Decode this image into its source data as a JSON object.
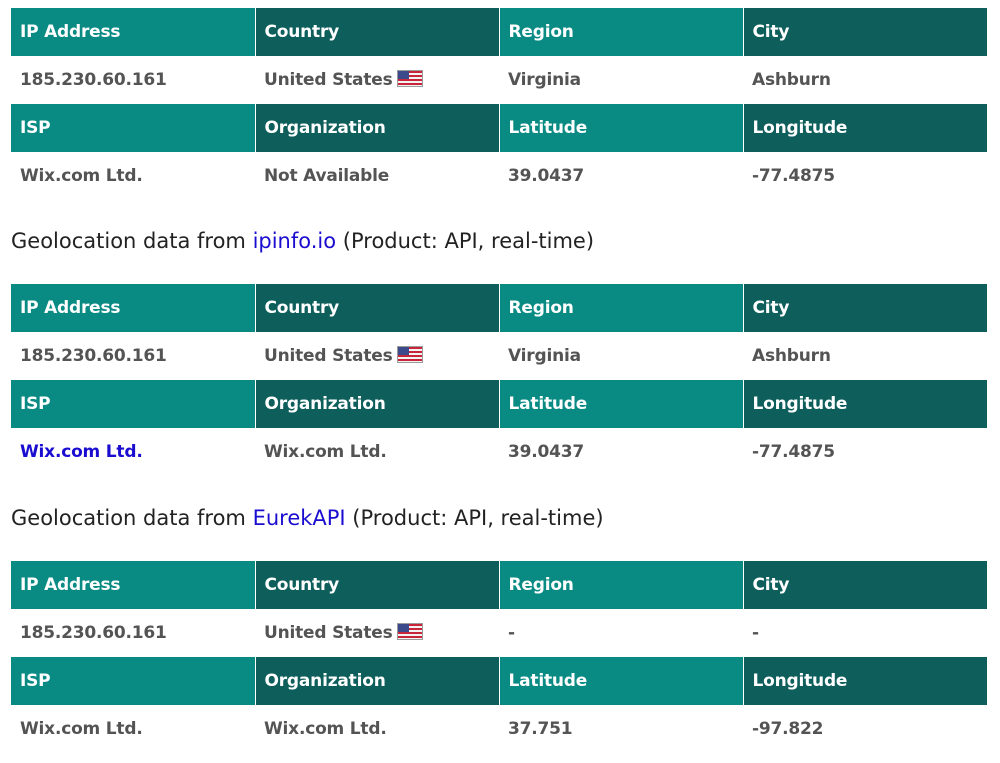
{
  "headers_top": [
    "IP Address",
    "Country",
    "Region",
    "City"
  ],
  "headers_bottom": [
    "ISP",
    "Organization",
    "Latitude",
    "Longitude"
  ],
  "flag_icon": "us-flag-icon",
  "colors": {
    "header_light": "#098b84",
    "header_dark": "#0e5f5c",
    "link": "#1a0dd0",
    "value_text": "#545454"
  },
  "section1": {
    "ip": "185.230.60.161",
    "country": "United States",
    "region": "Virginia",
    "city": "Ashburn",
    "isp": "Wix.com Ltd.",
    "organization": "Not Available",
    "latitude": "39.0437",
    "longitude": "-77.4875"
  },
  "section2": {
    "caption_prefix": "Geolocation data from ",
    "provider": "ipinfo.io",
    "caption_suffix": " (Product: API, real-time)",
    "ip": "185.230.60.161",
    "country": "United States",
    "region": "Virginia",
    "city": "Ashburn",
    "isp": "Wix.com Ltd.",
    "organization": "Wix.com Ltd.",
    "latitude": "39.0437",
    "longitude": "-77.4875"
  },
  "section3": {
    "caption_prefix": "Geolocation data from ",
    "provider": "EurekAPI",
    "caption_suffix": " (Product: API, real-time)",
    "ip": "185.230.60.161",
    "country": "United States",
    "region": "-",
    "city": "-",
    "isp": "Wix.com Ltd.",
    "organization": "Wix.com Ltd.",
    "latitude": "37.751",
    "longitude": "-97.822"
  }
}
